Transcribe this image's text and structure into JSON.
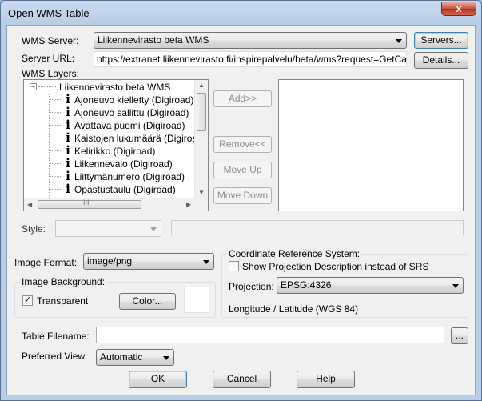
{
  "window": {
    "title": "Open WMS Table"
  },
  "wms_server": {
    "label": "WMS Server:",
    "value": "Liikennevirasto beta WMS",
    "servers_button": "Servers..."
  },
  "server_url": {
    "label": "Server URL:",
    "value": "https://extranet.liikennevirasto.fi/inspirepalvelu/beta/wms?request=GetCapabilitie",
    "details_button": "Details..."
  },
  "wms_layers": {
    "label": "WMS Layers:",
    "root": "Liikennevirasto beta WMS",
    "items": [
      "Ajoneuvo kielletty (Digiroad)",
      "Ajoneuvo sallittu (Digiroad)",
      "Avattava puomi (Digiroad)",
      "Kaistojen lukumäärä (Digiroad)",
      "Kelirikko (Digiroad)",
      "Liikennevalo (Digiroad)",
      "Liittymänumero (Digiroad)",
      "Opastustaulu (Digiroad)"
    ],
    "scroll_thumb_glyph": "III"
  },
  "buttons": {
    "add": "Add>>",
    "remove": "Remove<<",
    "move_up": "Move Up",
    "move_down": "Move Down",
    "color": "Color...",
    "browse": "...",
    "ok": "OK",
    "cancel": "Cancel",
    "help": "Help",
    "close_glyph": "x"
  },
  "style": {
    "label": "Style:",
    "value": ""
  },
  "image_format": {
    "label": "Image Format:",
    "value": "image/png"
  },
  "image_background": {
    "label": "Image Background:",
    "transparent_label": "Transparent",
    "transparent_checked": true,
    "check_glyph": "✓"
  },
  "crs": {
    "title": "Coordinate Reference System:",
    "show_projection_label": "Show Projection Description instead of SRS",
    "show_projection_checked": false,
    "projection_label": "Projection:",
    "projection_value": "EPSG:4326",
    "description": "Longitude / Latitude (WGS 84)"
  },
  "table_filename": {
    "label": "Table Filename:",
    "value": ""
  },
  "preferred_view": {
    "label": "Preferred View:",
    "value": "Automatic"
  }
}
